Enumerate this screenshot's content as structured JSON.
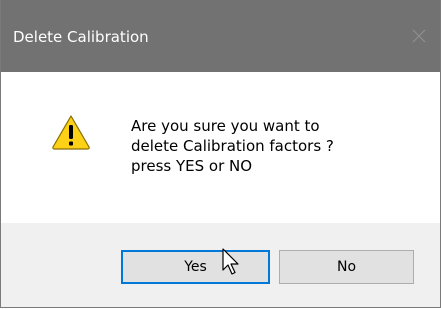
{
  "dialog": {
    "title": "Delete Calibration",
    "message_lines": [
      "Are you sure you want to",
      "delete Calibration factors ?",
      "press  YES  or  NO"
    ],
    "icon": "warning-icon"
  },
  "buttons": {
    "yes_label": "Yes",
    "no_label": "No"
  },
  "colors": {
    "titlebar": "#727272",
    "focus_border": "#0078d7",
    "footer": "#f0f0f0",
    "button": "#e1e1e1",
    "warning": "#fcd116"
  }
}
